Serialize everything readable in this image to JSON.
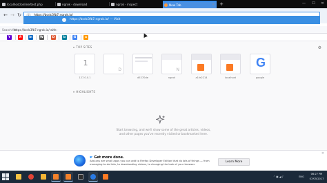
{
  "tabs": [
    {
      "label": "localhost/online/test.php",
      "active": false
    },
    {
      "label": "ngrok - download",
      "active": false
    },
    {
      "label": "ngrok - inspect",
      "active": false
    },
    {
      "label": "New Tab",
      "active": true
    }
  ],
  "urlbar": {
    "value": "https://bcdc3fb7.ngrok.io/",
    "suggestion_url": "https://bcdc3fb7.ngrok.io/",
    "suggestion_action": "Visit",
    "suggestion_separator": "—"
  },
  "search_with": {
    "label": "Search for",
    "query": "https://bcdc3fb7.ngrok.io/ with:"
  },
  "search_engines": [
    {
      "name": "yahoo-engine-icon",
      "glyph": "Y",
      "color": "#6001d2"
    },
    {
      "name": "yandex-engine-icon",
      "glyph": "Я",
      "color": "#ff0000"
    },
    {
      "name": "linkedin-engine-icon",
      "glyph": "in",
      "color": "#0a66c2"
    },
    {
      "name": "wikipedia-engine-icon",
      "glyph": "W",
      "color": "#5a5a5a"
    },
    {
      "name": "duckduckgo-engine-icon",
      "glyph": "D",
      "color": "#de5833"
    },
    {
      "name": "bing-engine-icon",
      "glyph": "b",
      "color": "#00809d"
    },
    {
      "name": "google-engine-icon",
      "glyph": "G",
      "color": "#4285f4"
    },
    {
      "name": "amazon-engine-icon",
      "glyph": "a",
      "color": "#ff9900"
    },
    {
      "name": "settings-engine-icon",
      "glyph": "⚙",
      "color": "#8a8a8a"
    }
  ],
  "top_sites": {
    "heading": "TOP SITES",
    "tiles": [
      {
        "label": "127.0.0.1",
        "letter": "1"
      },
      {
        "label": "",
        "letter": "D"
      },
      {
        "label": "d5270de",
        "letter": ""
      },
      {
        "label": "ngrok",
        "letter": "N"
      },
      {
        "label": "a1fe2214",
        "letter": ""
      },
      {
        "label": "localhost",
        "letter": ""
      },
      {
        "label": "google",
        "letter": "G"
      }
    ]
  },
  "highlights": {
    "heading": "HIGHLIGHTS",
    "empty_message": "Start browsing, and we'll show some of the great articles, videos, and other pages you've recently visited or bookmarked here."
  },
  "snippet": {
    "title": "Get more done.",
    "body": "Add-ons are small apps you can add to Firefox Developer Edition that do lots of things — from managing to-do lists, to downloading videos, to changing the look of your browser.",
    "button": "Learn More"
  },
  "taskbar": {
    "lang": "ENG",
    "time": "06:27 PM",
    "date": "07/05/2017"
  },
  "colors": {
    "accent": "#0a84ff",
    "suggestion_bg": "#3a8fe3",
    "taskbar_bg": "#1b2a3a"
  }
}
